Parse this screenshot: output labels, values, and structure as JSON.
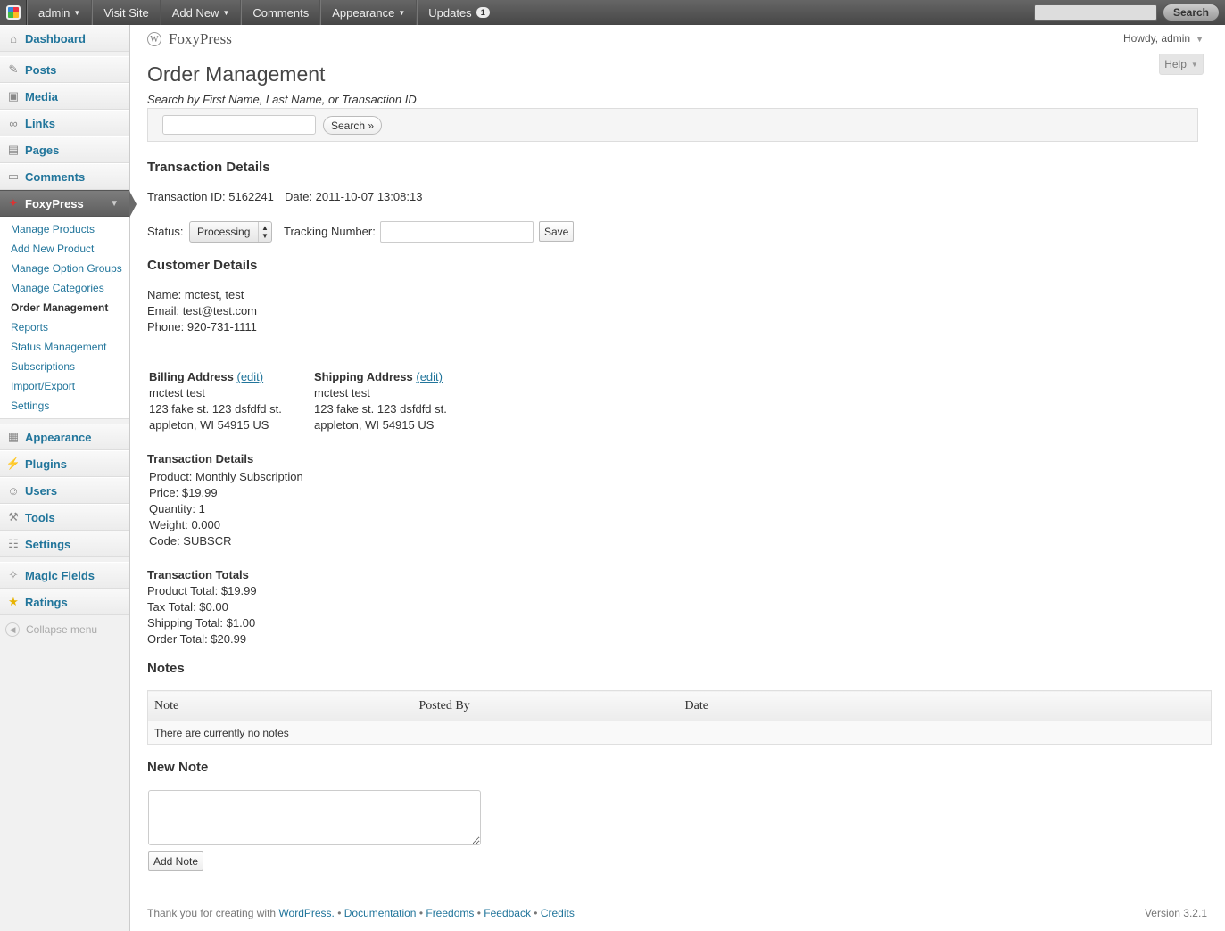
{
  "adminbar": {
    "user": "admin",
    "items": [
      "Visit Site",
      "Add New",
      "Comments",
      "Appearance",
      "Updates"
    ],
    "updates_count": "1",
    "search_button": "Search"
  },
  "sidebar": {
    "top1": "Dashboard",
    "items_a": [
      "Posts",
      "Media",
      "Links",
      "Pages",
      "Comments"
    ],
    "current": "FoxyPress",
    "sub": [
      "Manage Products",
      "Add New Product",
      "Manage Option Groups",
      "Manage Categories",
      "Order Management",
      "Reports",
      "Status Management",
      "Subscriptions",
      "Import/Export",
      "Settings"
    ],
    "items_b": [
      "Appearance",
      "Plugins",
      "Users",
      "Tools",
      "Settings"
    ],
    "items_c": [
      "Magic Fields",
      "Ratings"
    ],
    "collapse": "Collapse menu"
  },
  "header": {
    "site_name": "FoxyPress",
    "howdy": "Howdy, admin",
    "help": "Help"
  },
  "page": {
    "title": "Order Management",
    "search_hint": "Search by First Name, Last Name, or Transaction ID",
    "search_button": "Search »"
  },
  "transaction": {
    "heading": "Transaction Details",
    "id_text": "Transaction ID: 5162241",
    "date_text": "Date: 2011-10-07 13:08:13",
    "status_label": "Status:",
    "status_value": "Processing",
    "tracking_label": "Tracking Number:",
    "save": "Save"
  },
  "customer": {
    "heading": "Customer Details",
    "name": "Name: mctest, test",
    "email": "Email: test@test.com",
    "phone": "Phone: 920-731-1111"
  },
  "billing": {
    "title": "Billing Address",
    "edit": "(edit)",
    "lines": [
      "mctest test",
      "123 fake st. 123 dsfdfd st.",
      "appleton, WI 54915 US"
    ]
  },
  "shipping": {
    "title": "Shipping Address",
    "edit": "(edit)",
    "lines": [
      "mctest test",
      "123 fake st. 123 dsfdfd st.",
      "appleton, WI 54915 US"
    ]
  },
  "details": {
    "title": "Transaction Details",
    "lines": [
      "Product: Monthly Subscription",
      "Price: $19.99",
      "Quantity: 1",
      "Weight: 0.000",
      "Code: SUBSCR"
    ]
  },
  "totals": {
    "title": "Transaction Totals",
    "lines": [
      "Product Total: $19.99",
      "Tax Total: $0.00",
      "Shipping Total: $1.00",
      "Order Total: $20.99"
    ]
  },
  "notes": {
    "heading": "Notes",
    "columns": [
      "Note",
      "Posted By",
      "Date"
    ],
    "empty": "There are currently no notes",
    "new_heading": "New Note",
    "add_button": "Add Note"
  },
  "footer": {
    "thanks": "Thank you for creating with",
    "wordpress": "WordPress.",
    "links": [
      "Documentation",
      "Freedoms",
      "Feedback",
      "Credits"
    ],
    "sep": " • ",
    "version": "Version 3.2.1"
  },
  "colors": {
    "link": "#21759b",
    "adminbar": "#464646",
    "current_menu": "#6a6a6a"
  }
}
